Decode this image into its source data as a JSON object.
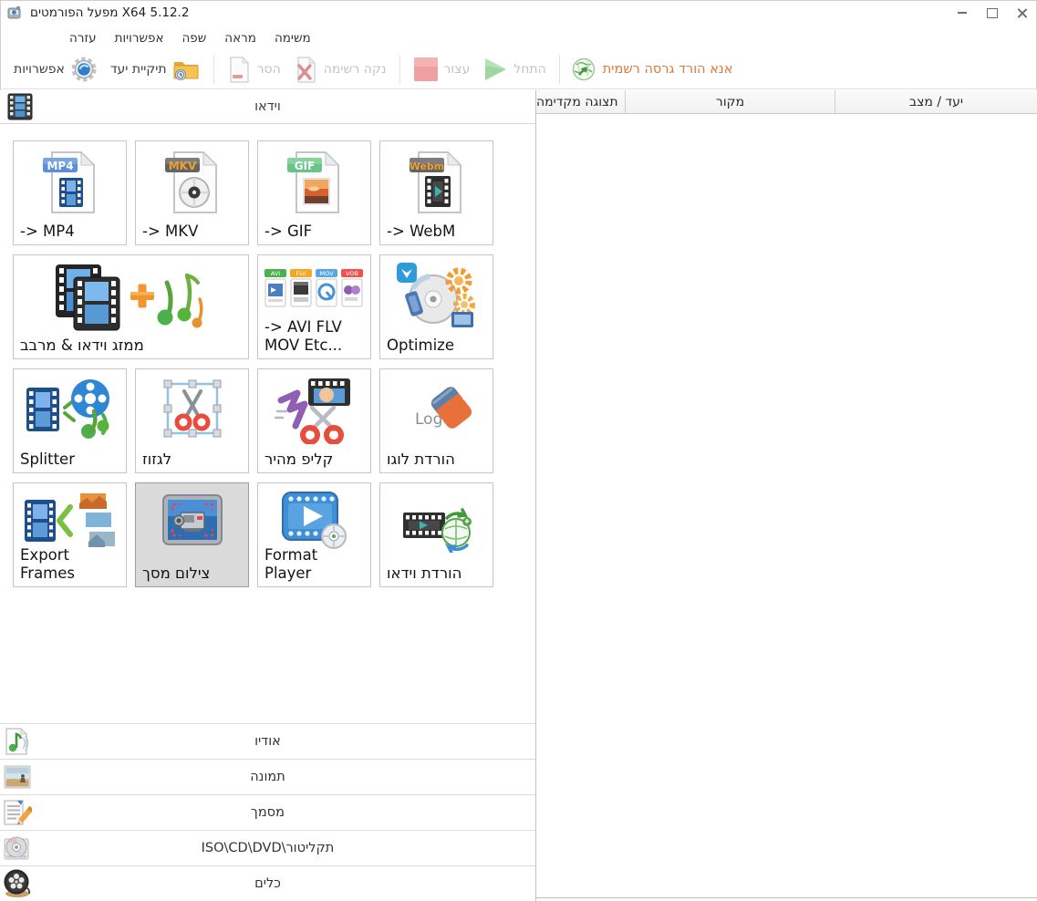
{
  "window": {
    "title": "מפעל הפורמטים X64 5.12.2"
  },
  "menu": {
    "items": [
      {
        "id": "help",
        "label": "עזרה"
      },
      {
        "id": "options",
        "label": "אפשרויות"
      },
      {
        "id": "language",
        "label": "שפה"
      },
      {
        "id": "view",
        "label": "מראה"
      },
      {
        "id": "task",
        "label": "משימה"
      }
    ]
  },
  "toolbar": {
    "options": {
      "label": "אפשרויות",
      "icon": "gear-icon",
      "enabled": true
    },
    "output_folder": {
      "label": "תיקיית יעד",
      "icon": "folder-clock-icon",
      "enabled": true
    },
    "remove": {
      "label": "הסר",
      "icon": "remove-document-icon",
      "enabled": false
    },
    "clear_list": {
      "label": "נקה רשימה",
      "icon": "clear-list-icon",
      "enabled": false
    },
    "stop": {
      "label": "עצור",
      "icon": "stop-square-icon",
      "enabled": false
    },
    "start": {
      "label": "התחל",
      "icon": "play-triangle-icon",
      "enabled": false
    },
    "download_official": {
      "label": "אנא הורד גרסה רשמית",
      "icon": "globe-icon"
    }
  },
  "video_section": {
    "title": "וידאו",
    "buttons": [
      {
        "id": "to-mp4",
        "label": "-> MP4",
        "label2": "",
        "dir": "ltr",
        "selected": false
      },
      {
        "id": "to-mkv",
        "label": "-> MKV",
        "label2": "",
        "dir": "ltr",
        "selected": false
      },
      {
        "id": "to-gif",
        "label": "-> GIF",
        "label2": "",
        "dir": "ltr",
        "selected": false
      },
      {
        "id": "to-webm",
        "label": "-> WebM",
        "label2": "",
        "dir": "ltr",
        "selected": false
      },
      {
        "id": "video-joiner-mux",
        "label": "ממזג וידאו & מרבב",
        "label2": "",
        "dir": "rtl",
        "selected": false
      },
      {
        "id": "to-avi-flv-mov",
        "label": "-> AVI FLV",
        "label2": "MOV Etc...",
        "dir": "ltr",
        "selected": false
      },
      {
        "id": "optimize",
        "label": "Optimize",
        "label2": "",
        "dir": "ltr",
        "selected": false
      },
      {
        "id": "splitter",
        "label": "Splitter",
        "label2": "",
        "dir": "ltr",
        "selected": false
      },
      {
        "id": "crop",
        "label": "לגזוז",
        "label2": "",
        "dir": "rtl",
        "selected": false
      },
      {
        "id": "fast-clip",
        "label": "קליפ מהיר",
        "label2": "",
        "dir": "rtl",
        "selected": false
      },
      {
        "id": "remove-logo",
        "label": "הורדת לוגו",
        "label2": "",
        "dir": "rtl",
        "selected": false
      },
      {
        "id": "export-frames",
        "label": "Export",
        "label2": "Frames",
        "dir": "ltr",
        "selected": false
      },
      {
        "id": "screen-record",
        "label": "צילום מסך",
        "label2": "",
        "dir": "rtl",
        "selected": true
      },
      {
        "id": "format-player",
        "label": "Format",
        "label2": "Player",
        "dir": "ltr",
        "selected": false
      },
      {
        "id": "video-download",
        "label": "הורדת וידאו",
        "label2": "",
        "dir": "rtl",
        "selected": false
      }
    ]
  },
  "sections": [
    {
      "id": "audio",
      "label": "אודיו",
      "icon": "audio-note-icon"
    },
    {
      "id": "picture",
      "label": "תמונה",
      "icon": "picture-icon"
    },
    {
      "id": "document",
      "label": "מסמך",
      "icon": "document-pencil-icon"
    },
    {
      "id": "rom",
      "label": "תקליטור\\ISO\\CD\\DVD",
      "icon": "disc-icon"
    },
    {
      "id": "tools",
      "label": "כלים",
      "icon": "film-reel-icon"
    }
  ],
  "table": {
    "columns": [
      {
        "id": "preview",
        "label": "תצוגה מקדימה"
      },
      {
        "id": "source",
        "label": "מקור"
      },
      {
        "id": "target",
        "label": "יעד / מצב"
      }
    ],
    "rows": []
  },
  "colors": {
    "promo_orange": "#e0783a",
    "selected_bg": "#dadada",
    "start_green": "#9fd6a2",
    "stop_red": "#efa0a0",
    "accent_blue": "#3f8fd6"
  }
}
